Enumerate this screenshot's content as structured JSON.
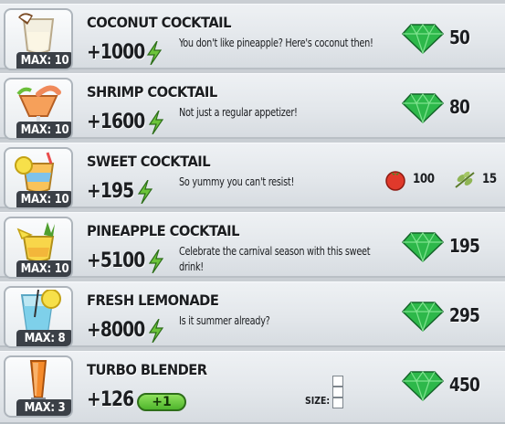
{
  "items": [
    {
      "title": "COCONUT COCKTAIL",
      "max": "MAX: 10",
      "xp": "+1000",
      "description": "You don't like pineapple? Here's coconut then!",
      "price": "50",
      "icon": "coconut-cocktail-icon"
    },
    {
      "title": "SHRIMP COCKTAIL",
      "max": "MAX: 10",
      "xp": "+1600",
      "description": "Not just a regular appetizer!",
      "price": "80",
      "icon": "shrimp-cocktail-icon"
    },
    {
      "title": "SWEET COCKTAIL",
      "max": "MAX: 10",
      "xp": "+195",
      "description": "So yummy you can't resist!",
      "resources": [
        {
          "icon": "tomato-icon",
          "value": "100"
        },
        {
          "icon": "herb-icon",
          "value": "15"
        }
      ],
      "icon": "sweet-cocktail-icon"
    },
    {
      "title": "PINEAPPLE COCKTAIL",
      "max": "MAX: 10",
      "xp": "+5100",
      "description": "Celebrate the carnival season with this sweet drink!",
      "price": "195",
      "icon": "pineapple-cocktail-icon"
    },
    {
      "title": "FRESH LEMONADE",
      "max": "MAX: 8",
      "xp": "+8000",
      "description": "Is it summer already?",
      "price": "295",
      "icon": "lemonade-icon"
    },
    {
      "title": "TURBO BLENDER",
      "max": "MAX: 3",
      "xp": "+126",
      "boost": "+1",
      "size_label": "SIZE:",
      "price": "450",
      "icon": "blender-icon"
    }
  ],
  "colors": {
    "gem": "#2db84a",
    "bolt": "#6cc43a",
    "tag": "#3b4047"
  }
}
